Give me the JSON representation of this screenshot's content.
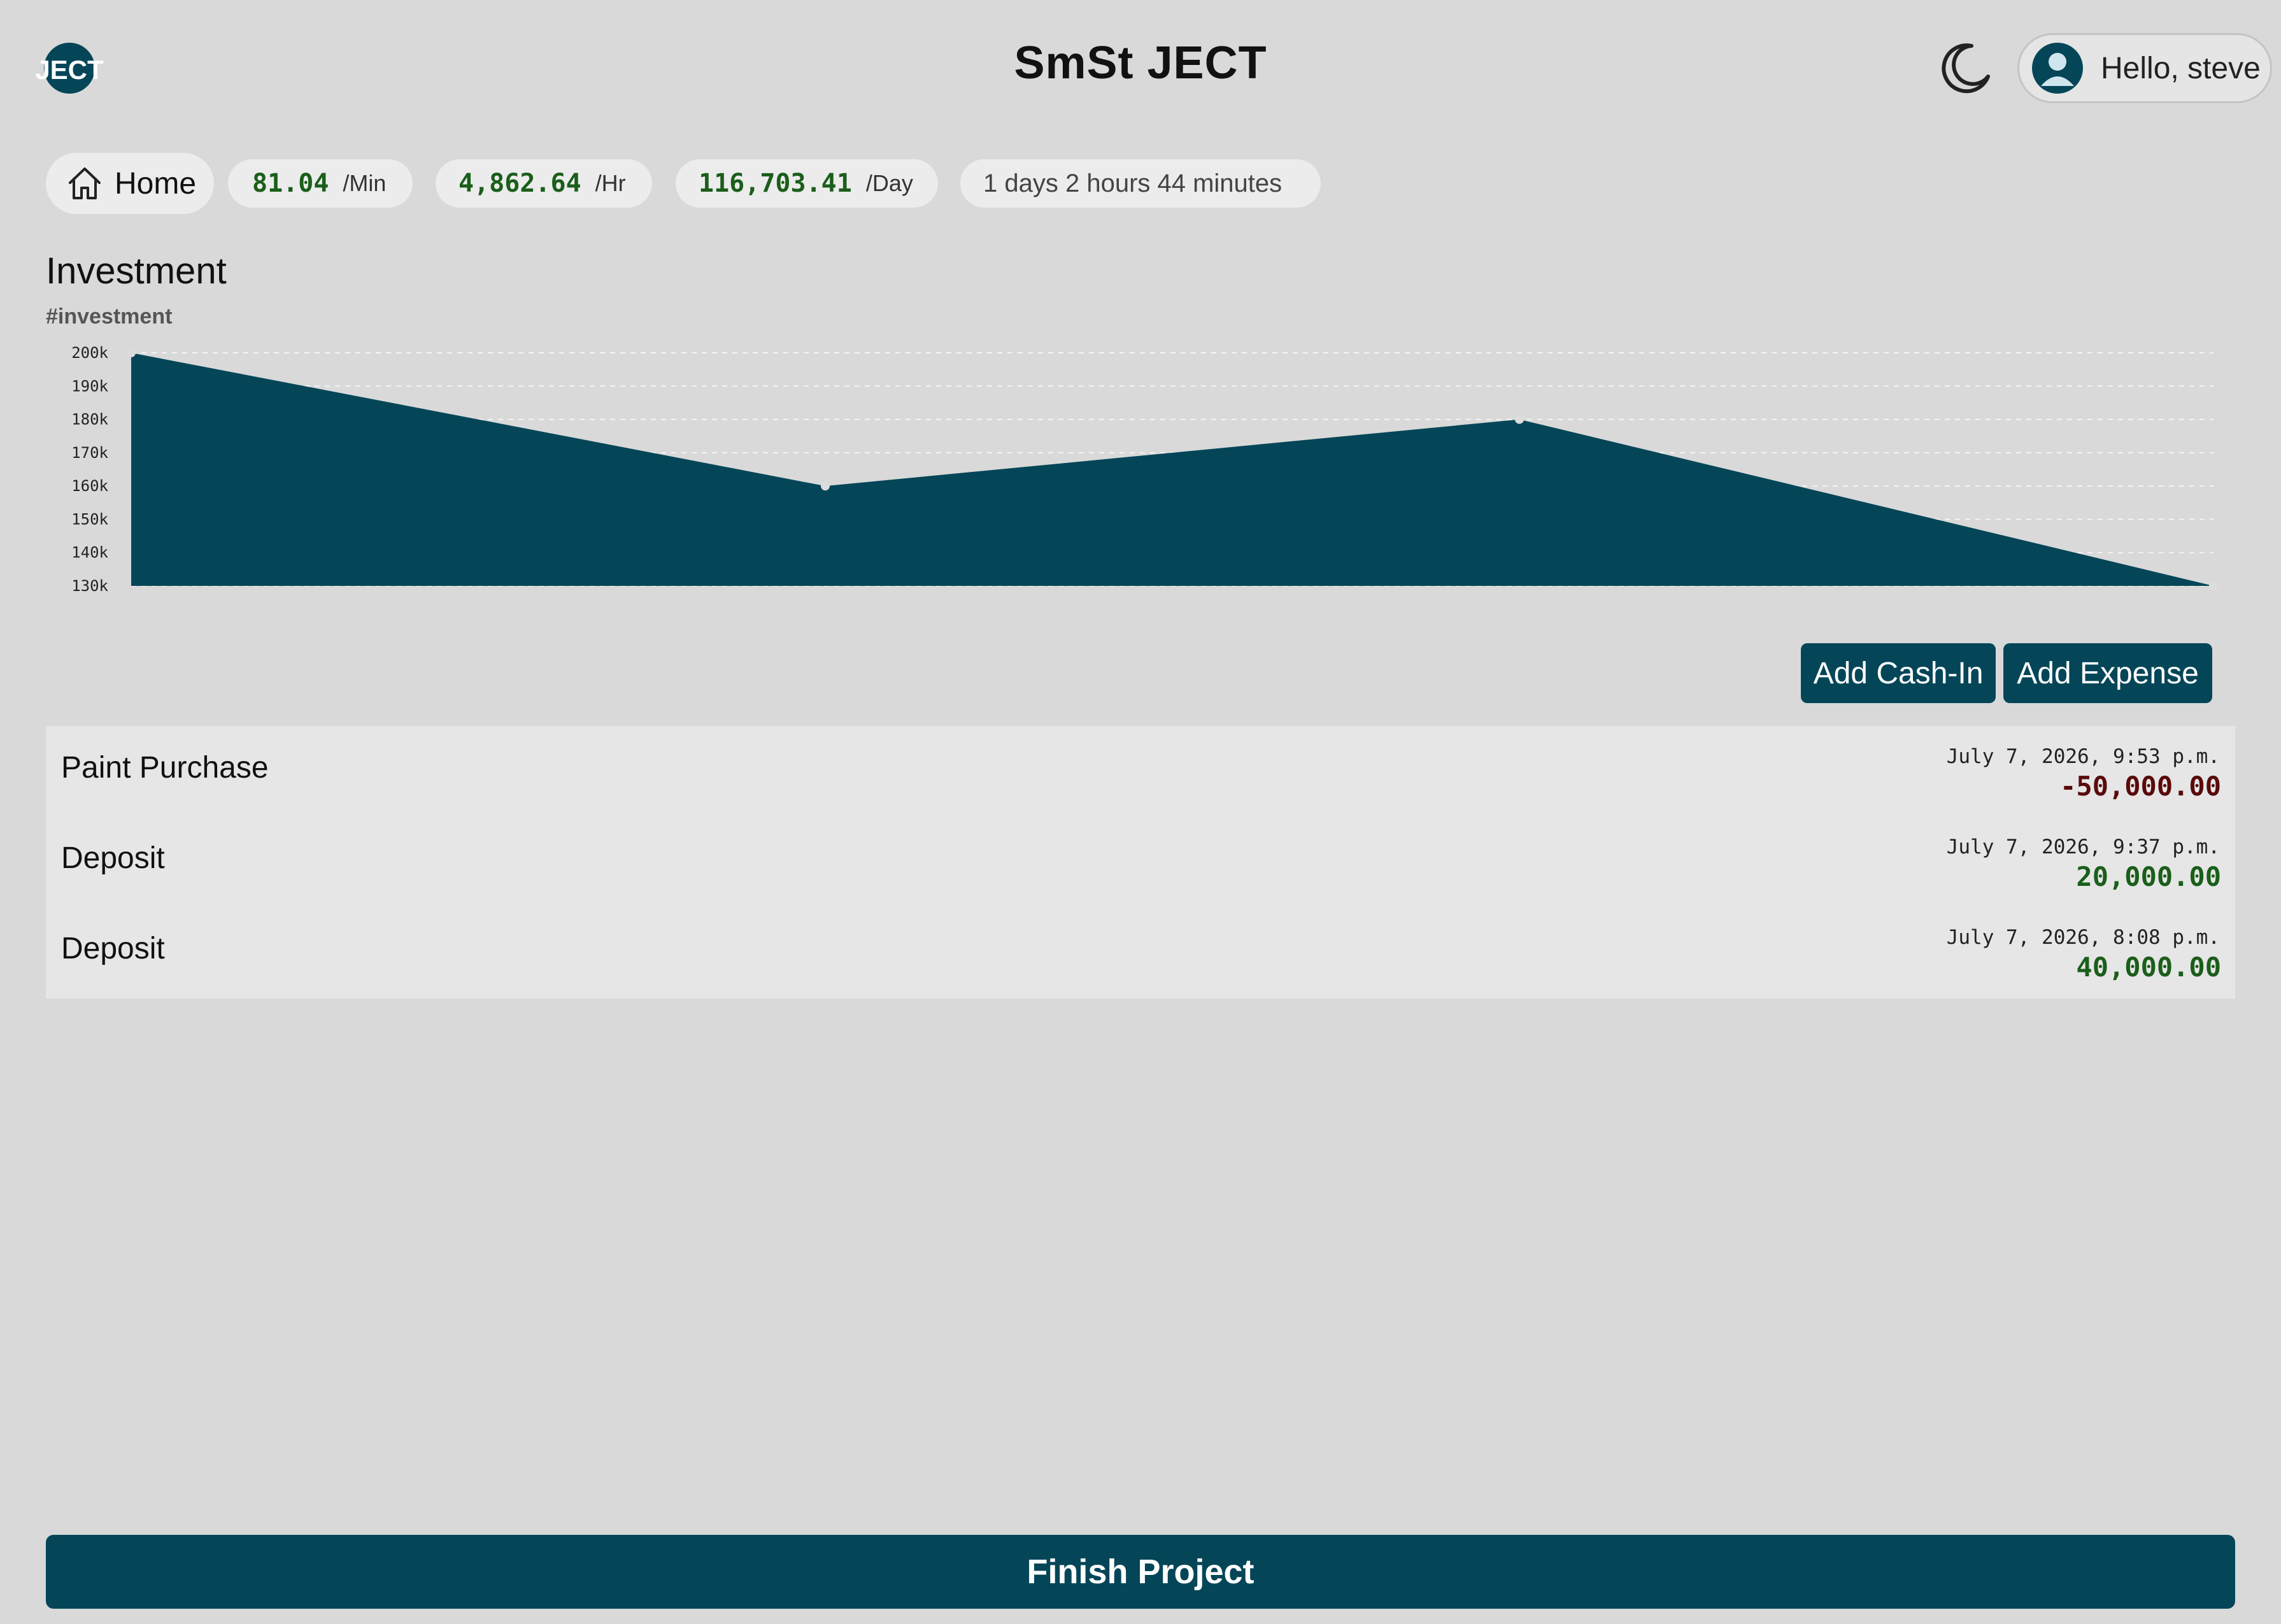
{
  "header": {
    "title": "SmSt JECT",
    "greeting": "Hello, steve",
    "logo_text": "JECT",
    "theme_icon": "moon-icon",
    "avatar_icon": "user-avatar-icon"
  },
  "stats": {
    "home_label": "Home",
    "per_min_value": "81.04",
    "per_min_unit": "/Min",
    "per_hr_value": "4,862.64",
    "per_hr_unit": "/Hr",
    "per_day_value": "116,703.41",
    "per_day_unit": "/Day",
    "duration": "1 days 2 hours 44 minutes"
  },
  "section": {
    "title": "Investment",
    "tag": "#investment"
  },
  "chart_data": {
    "type": "area",
    "x": [
      0,
      1,
      2,
      3
    ],
    "values": [
      200000,
      160000,
      180000,
      130000
    ],
    "ylim": [
      130000,
      200000
    ],
    "yticks": [
      130000,
      140000,
      150000,
      160000,
      170000,
      180000,
      190000,
      200000
    ],
    "ytick_labels": [
      "130k",
      "140k",
      "150k",
      "160k",
      "170k",
      "180k",
      "190k",
      "200k"
    ],
    "grid": true,
    "color": "#044658"
  },
  "actions": {
    "add_cash_in": "Add Cash-In",
    "add_expense": "Add Expense",
    "finish": "Finish Project"
  },
  "transactions": [
    {
      "name": "Paint Purchase",
      "date": "July 7, 2026, 9:53 p.m.",
      "amount": "-50,000.00",
      "type": "expense"
    },
    {
      "name": "Deposit",
      "date": "July 7, 2026, 9:37 p.m.",
      "amount": "20,000.00",
      "type": "income"
    },
    {
      "name": "Deposit",
      "date": "July 7, 2026, 8:08 p.m.",
      "amount": "40,000.00",
      "type": "income"
    }
  ],
  "colors": {
    "primary": "#044658",
    "positive": "#1a5e1a",
    "negative": "#5a0a0a",
    "background": "#d9d9d9"
  }
}
